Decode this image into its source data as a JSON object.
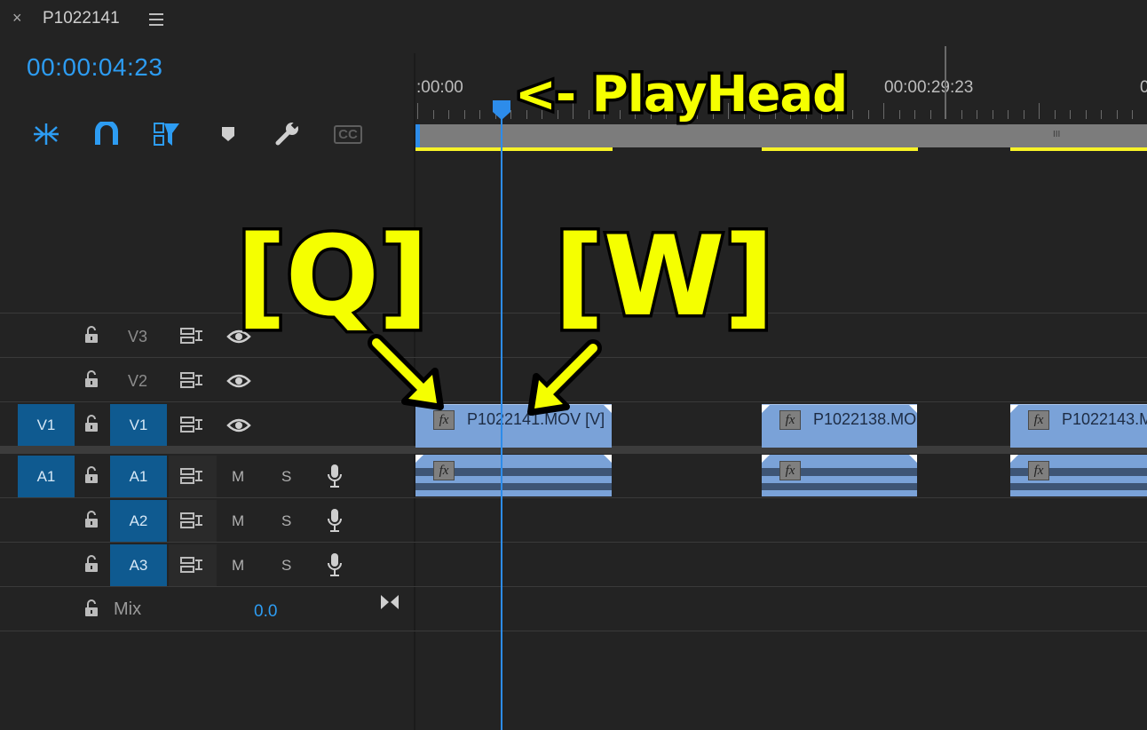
{
  "header": {
    "close_glyph": "×",
    "sequence_title": "P1022141",
    "timecode": "00:00:04:23"
  },
  "tools": [
    "ripple-insert-icon",
    "snap-magnet-icon",
    "linked-selection-icon",
    "marker-icon",
    "wrench-icon",
    "captions-icon"
  ],
  "tools_captions_label": "CC",
  "ruler": {
    "start_label": ":00:00",
    "mid_label": "00:00:29:23",
    "end_label": "0",
    "zoom_grip": "III"
  },
  "tracks": {
    "v3": {
      "label": "V3"
    },
    "v2": {
      "label": "V2"
    },
    "v1": {
      "source": "V1",
      "label": "V1"
    },
    "a1": {
      "source": "A1",
      "label": "A1",
      "m": "M",
      "s": "S"
    },
    "a2": {
      "label": "A2",
      "m": "M",
      "s": "S"
    },
    "a3": {
      "label": "A3",
      "m": "M",
      "s": "S"
    },
    "mix": {
      "label": "Mix",
      "value": "0.0"
    }
  },
  "clips": {
    "c1": {
      "name": "P1022141.MOV [V]",
      "fx": "fx"
    },
    "c2": {
      "name": "P1022138.MO",
      "fx": "fx"
    },
    "c3": {
      "name": "P1022143.M",
      "fx": "fx"
    }
  },
  "annotations": {
    "playhead": "<- PlayHead",
    "q": "[Q]",
    "w": "[W]"
  },
  "colors": {
    "accent": "#2d9cf2",
    "clip": "#7aa2d8",
    "annotation": "#f5ff00",
    "track_target": "#0f5a90"
  }
}
